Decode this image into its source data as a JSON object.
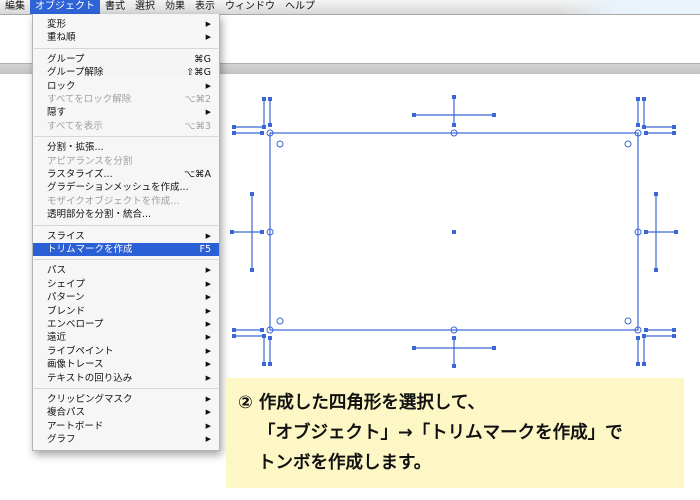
{
  "menubar": {
    "items": [
      {
        "label": "編集",
        "active": false
      },
      {
        "label": "オブジェクト",
        "active": true
      },
      {
        "label": "書式",
        "active": false
      },
      {
        "label": "選択",
        "active": false
      },
      {
        "label": "効果",
        "active": false
      },
      {
        "label": "表示",
        "active": false
      },
      {
        "label": "ウィンドウ",
        "active": false
      },
      {
        "label": "ヘルプ",
        "active": false
      }
    ],
    "accent": "#2f63d8"
  },
  "dropdown": {
    "highlight_color": "#2a5fd6",
    "groups": [
      [
        {
          "label": "変形",
          "shortcut": "",
          "submenu": true,
          "disabled": false
        },
        {
          "label": "重ね順",
          "shortcut": "",
          "submenu": true,
          "disabled": false
        }
      ],
      [
        {
          "label": "グループ",
          "shortcut": "⌘G",
          "submenu": false,
          "disabled": false
        },
        {
          "label": "グループ解除",
          "shortcut": "⇧⌘G",
          "submenu": false,
          "disabled": false
        },
        {
          "label": "ロック",
          "shortcut": "",
          "submenu": true,
          "disabled": false
        },
        {
          "label": "すべてをロック解除",
          "shortcut": "⌥⌘2",
          "submenu": false,
          "disabled": true
        },
        {
          "label": "隠す",
          "shortcut": "",
          "submenu": true,
          "disabled": false
        },
        {
          "label": "すべてを表示",
          "shortcut": "⌥⌘3",
          "submenu": false,
          "disabled": true
        }
      ],
      [
        {
          "label": "分割・拡張...",
          "shortcut": "",
          "submenu": false,
          "disabled": false
        },
        {
          "label": "アピアランスを分割",
          "shortcut": "",
          "submenu": false,
          "disabled": true
        },
        {
          "label": "ラスタライズ...",
          "shortcut": "⌥⌘A",
          "submenu": false,
          "disabled": false
        },
        {
          "label": "グラデーションメッシュを作成...",
          "shortcut": "",
          "submenu": false,
          "disabled": false
        },
        {
          "label": "モザイクオブジェクトを作成...",
          "shortcut": "",
          "submenu": false,
          "disabled": true
        },
        {
          "label": "透明部分を分割・統合...",
          "shortcut": "",
          "submenu": false,
          "disabled": false
        }
      ],
      [
        {
          "label": "スライス",
          "shortcut": "",
          "submenu": true,
          "disabled": false
        },
        {
          "label": "トリムマークを作成",
          "shortcut": "F5",
          "submenu": false,
          "disabled": false,
          "highlighted": true
        }
      ],
      [
        {
          "label": "パス",
          "shortcut": "",
          "submenu": true,
          "disabled": false
        },
        {
          "label": "シェイプ",
          "shortcut": "",
          "submenu": true,
          "disabled": false
        },
        {
          "label": "パターン",
          "shortcut": "",
          "submenu": true,
          "disabled": false
        },
        {
          "label": "ブレンド",
          "shortcut": "",
          "submenu": true,
          "disabled": false
        },
        {
          "label": "エンベロープ",
          "shortcut": "",
          "submenu": true,
          "disabled": false
        },
        {
          "label": "遠近",
          "shortcut": "",
          "submenu": true,
          "disabled": false
        },
        {
          "label": "ライブペイント",
          "shortcut": "",
          "submenu": true,
          "disabled": false
        },
        {
          "label": "画像トレース",
          "shortcut": "",
          "submenu": true,
          "disabled": false
        },
        {
          "label": "テキストの回り込み",
          "shortcut": "",
          "submenu": true,
          "disabled": false
        }
      ],
      [
        {
          "label": "クリッピングマスク",
          "shortcut": "",
          "submenu": true,
          "disabled": false
        },
        {
          "label": "複合パス",
          "shortcut": "",
          "submenu": true,
          "disabled": false
        },
        {
          "label": "アートボード",
          "shortcut": "",
          "submenu": true,
          "disabled": false
        },
        {
          "label": "グラフ",
          "shortcut": "",
          "submenu": true,
          "disabled": false
        }
      ]
    ]
  },
  "artwork": {
    "selection_color": "#3a66d6"
  },
  "caption": {
    "line1": "② 作成した四角形を選択して、",
    "line2": "「オブジェクト」→「トリムマークを作成」で",
    "line3": "トンボを作成します。",
    "background": "#fdf7c6"
  }
}
